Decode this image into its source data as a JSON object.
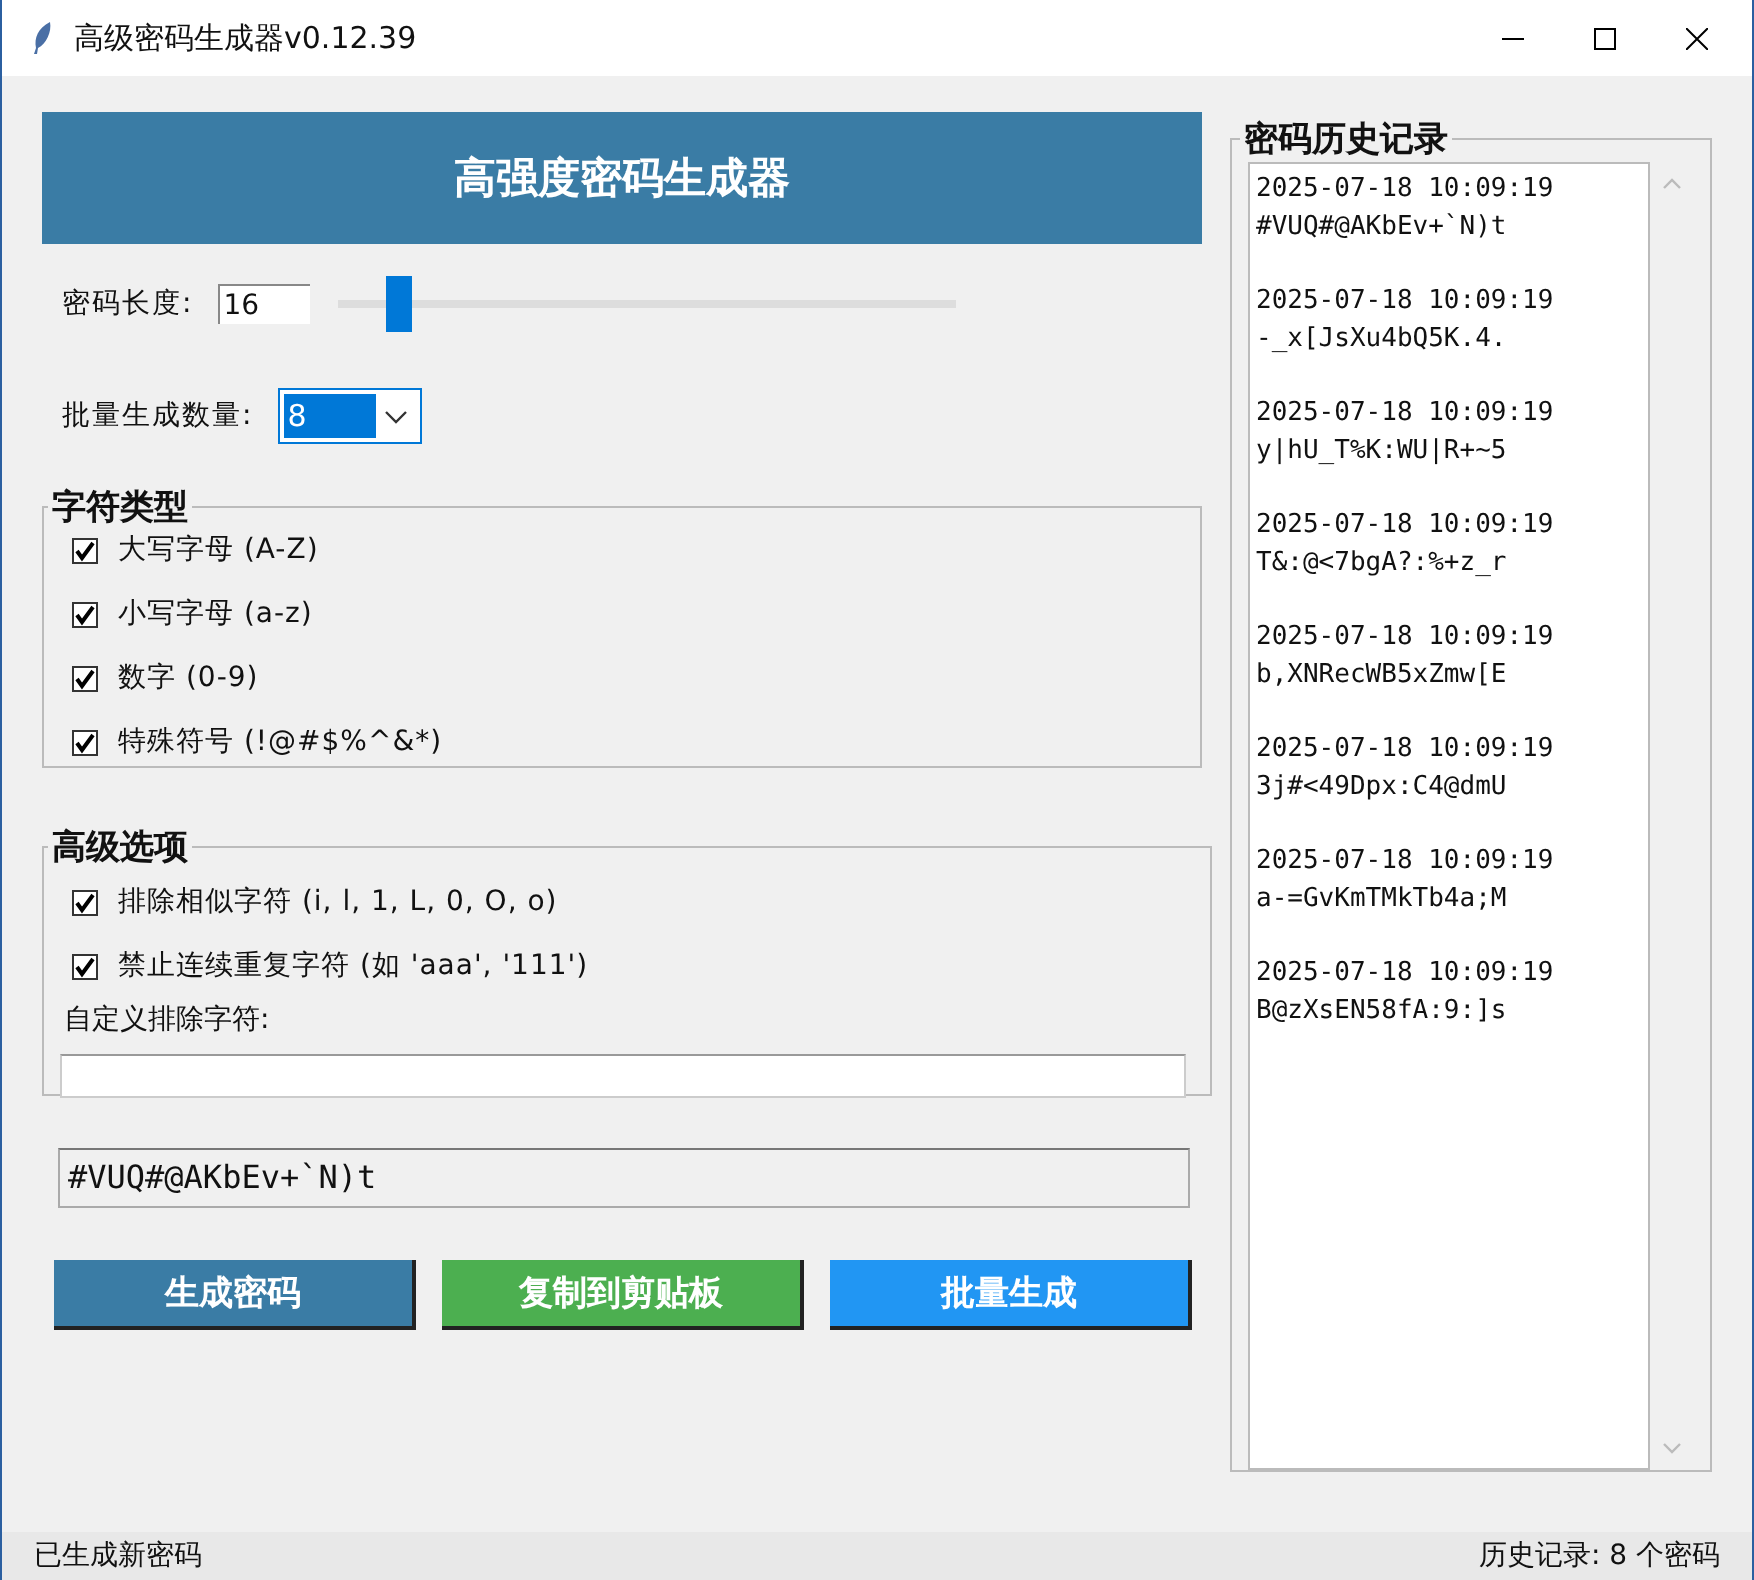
{
  "window": {
    "title": "高级密码生成器v0.12.39"
  },
  "banner": {
    "title": "高强度密码生成器"
  },
  "length": {
    "label": "密码长度:",
    "value": "16",
    "level": 0.08
  },
  "batch": {
    "label": "批量生成数量:",
    "value": "8"
  },
  "char_types": {
    "title": "字符类型",
    "options": [
      {
        "label": "大写字母 (A-Z)",
        "checked": true
      },
      {
        "label": "小写字母 (a-z)",
        "checked": true
      },
      {
        "label": "数字 (0-9)",
        "checked": true
      },
      {
        "label": "特殊符号 (!@#$%^&*)",
        "checked": true
      }
    ]
  },
  "advanced": {
    "title": "高级选项",
    "options": [
      {
        "label": "排除相似字符 (i, l, 1, L, 0, O, o)",
        "checked": true
      },
      {
        "label": "禁止连续重复字符 (如 'aaa', '111')",
        "checked": true
      }
    ],
    "custom_exclude": {
      "label": "自定义排除字符:"
    }
  },
  "password": {
    "value": "#VUQ#@AKbEv+`N)t"
  },
  "buttons": [
    {
      "label": "生成密码",
      "color": "#3a7ca5"
    },
    {
      "label": "复制到剪贴板",
      "color": "#4caf50"
    },
    {
      "label": "批量生成",
      "color": "#2196f3"
    }
  ],
  "history": {
    "title": "密码历史记录",
    "entries": [
      {
        "time": "2025-07-18 10:09:19",
        "password": "#VUQ#@AKbEv+`N)t"
      },
      {
        "time": "2025-07-18 10:09:19",
        "password": "-_x[JsXu4bQ5K.4."
      },
      {
        "time": "2025-07-18 10:09:19",
        "password": "y|hU_T%K:WU|R+~5"
      },
      {
        "time": "2025-07-18 10:09:19",
        "password": "T&:@<7bgA?:%+z_r"
      },
      {
        "time": "2025-07-18 10:09:19",
        "password": "b,XNRecWB5xZmw[E"
      },
      {
        "time": "2025-07-18 10:09:19",
        "password": "3j#<49Dpx:C4@dmU"
      },
      {
        "time": "2025-07-18 10:09:19",
        "password": "a-=GvKmTMkTb4a;M"
      },
      {
        "time": "2025-07-18 10:09:19",
        "password": "B@zXsEN58fA:9:]s"
      }
    ]
  },
  "status_bar": {
    "left": "已生成新密码",
    "right": "历史记录: 8 个密码"
  }
}
